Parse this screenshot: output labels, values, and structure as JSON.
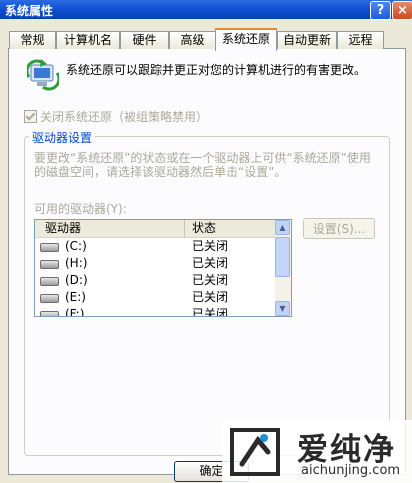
{
  "window": {
    "title": "系统属性",
    "help_label": "?",
    "close_label": "×"
  },
  "tabs": [
    {
      "label": "常规"
    },
    {
      "label": "计算机名"
    },
    {
      "label": "硬件"
    },
    {
      "label": "高级"
    },
    {
      "label": "系统还原"
    },
    {
      "label": "自动更新"
    },
    {
      "label": "远程"
    }
  ],
  "active_tab": "系统还原",
  "page": {
    "description": "系统还原可以跟踪并更正对您的计算机进行的有害更改。",
    "disable_checkbox_label": "关闭系统还原（被组策略禁用）",
    "disable_checkbox_checked": true
  },
  "drive_settings": {
    "group_title": "驱动器设置",
    "text": "要更改“系统还原”的状态或在一个驱动器上可供“系统还原”使用的磁盘空间，请选择该驱动器然后单击“设置”。",
    "available_label": "可用的驱动器(Y):",
    "columns": [
      "驱动器",
      "状态"
    ],
    "rows": [
      {
        "drive": "(C:)",
        "status": "已关闭"
      },
      {
        "drive": "(H:)",
        "status": "已关闭"
      },
      {
        "drive": "(D:)",
        "status": "已关闭"
      },
      {
        "drive": "(E:)",
        "status": "已关闭"
      },
      {
        "drive": "(F:)",
        "status": "已关闭"
      }
    ],
    "settings_button": "设置(S)..."
  },
  "buttons": {
    "ok": "确定"
  },
  "watermark": {
    "brand": "爱纯净",
    "url": "aichunjing.com"
  }
}
